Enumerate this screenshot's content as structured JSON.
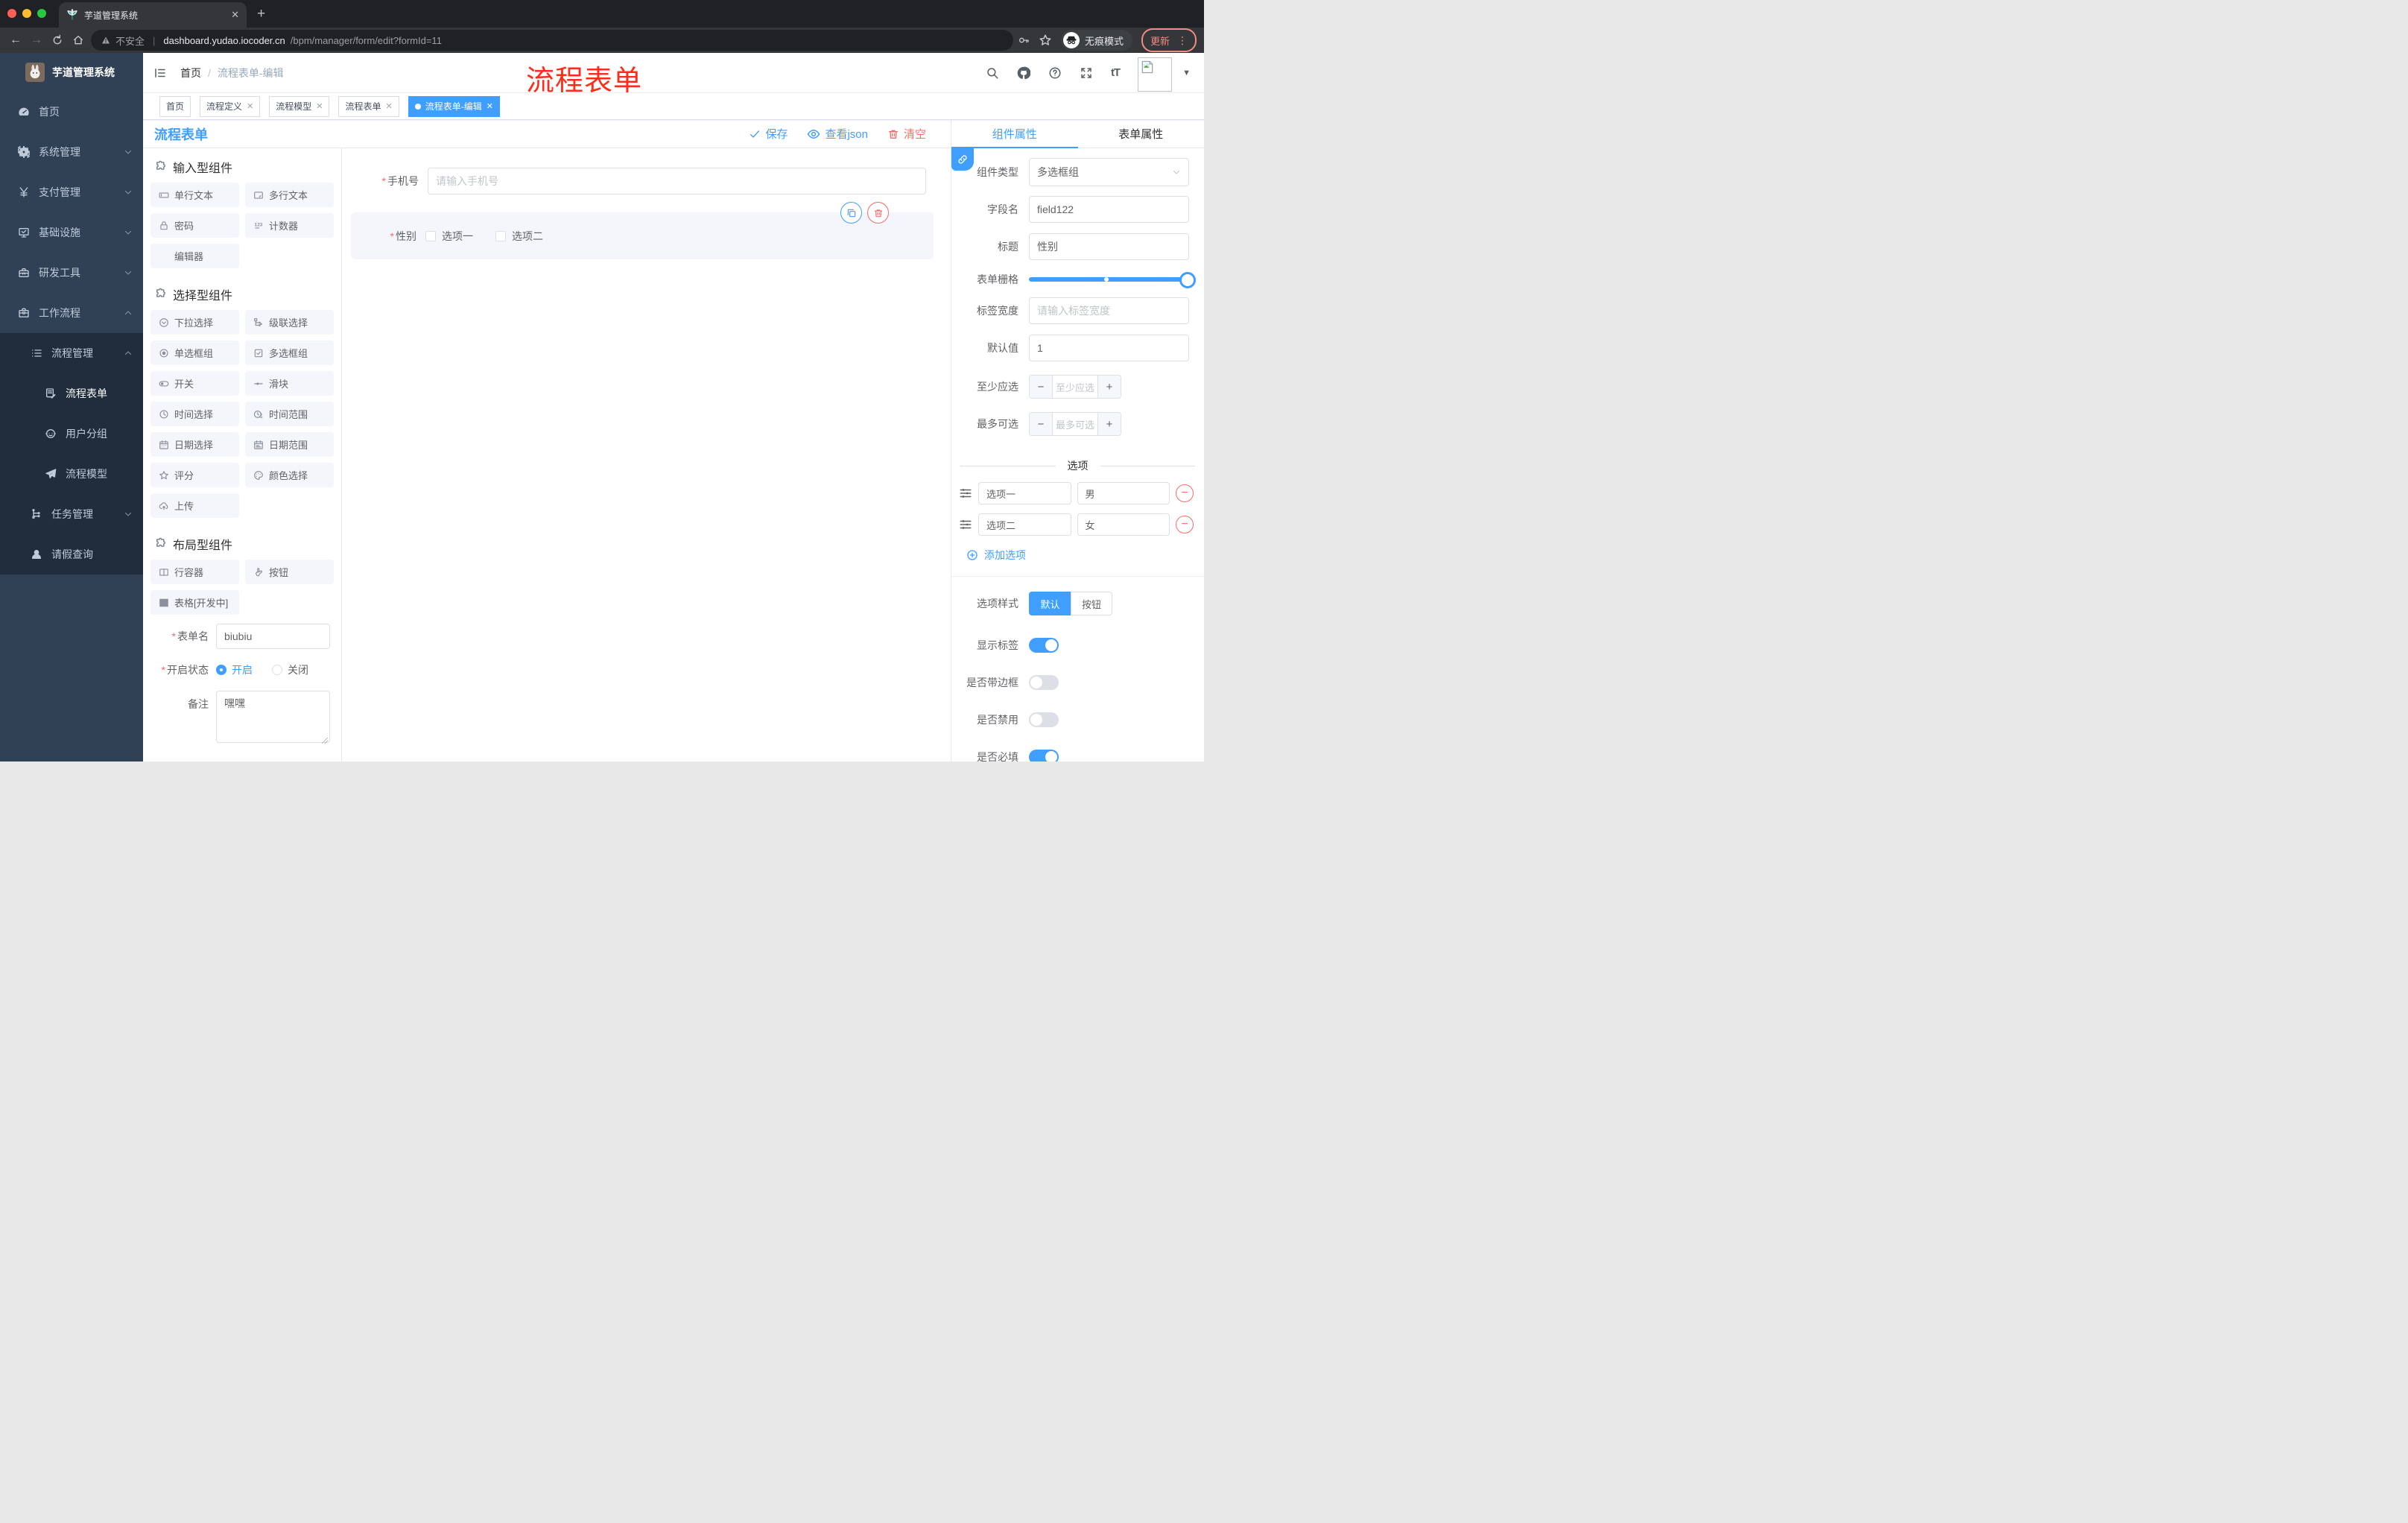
{
  "browser": {
    "tab_title": "芋道管理系统",
    "security_label": "不安全",
    "url_domain": "dashboard.yudao.iocoder.cn",
    "url_path": "/bpm/manager/form/edit?formId=11",
    "incognito_label": "无痕模式",
    "update_label": "更新"
  },
  "sidebar": {
    "logo_title": "芋道管理系统",
    "items": [
      {
        "label": "首页",
        "icon": "dashboard-icon"
      },
      {
        "label": "系统管理",
        "icon": "gear-icon"
      },
      {
        "label": "支付管理",
        "icon": "yen-icon"
      },
      {
        "label": "基础设施",
        "icon": "monitor-icon"
      },
      {
        "label": "研发工具",
        "icon": "toolbox-icon"
      },
      {
        "label": "工作流程",
        "icon": "briefcase-icon"
      }
    ],
    "submenu": {
      "parent": {
        "label": "流程管理",
        "icon": "list-tree-icon"
      },
      "children": [
        {
          "label": "流程表单",
          "icon": "doc-edit-icon"
        },
        {
          "label": "用户分组",
          "icon": "robot-icon"
        },
        {
          "label": "流程模型",
          "icon": "paper-plane-icon"
        }
      ],
      "siblings": [
        {
          "label": "任务管理",
          "icon": "branch-icon"
        },
        {
          "label": "请假查询",
          "icon": "person-icon"
        }
      ]
    }
  },
  "header": {
    "breadcrumb_home": "首页",
    "breadcrumb_current": "流程表单-编辑",
    "annotation": "流程表单"
  },
  "tags": [
    {
      "label": "首页",
      "closable": false,
      "active": false
    },
    {
      "label": "流程定义",
      "closable": true,
      "active": false
    },
    {
      "label": "流程模型",
      "closable": true,
      "active": false
    },
    {
      "label": "流程表单",
      "closable": true,
      "active": false
    },
    {
      "label": "流程表单-编辑",
      "closable": true,
      "active": true
    }
  ],
  "builder": {
    "title": "流程表单",
    "actions": {
      "save": "保存",
      "view_json": "查看json",
      "clear": "清空"
    },
    "left": {
      "sections": [
        {
          "title": "输入型组件",
          "items": [
            {
              "label": "单行文本",
              "icon": "input-box-icon"
            },
            {
              "label": "多行文本",
              "icon": "textarea-box-icon"
            },
            {
              "label": "密码",
              "icon": "lock-icon"
            },
            {
              "label": "计数器",
              "icon": "counter-icon"
            },
            {
              "label": "编辑器",
              "icon": ""
            }
          ]
        },
        {
          "title": "选择型组件",
          "items": [
            {
              "label": "下拉选择",
              "icon": "select-circle-icon"
            },
            {
              "label": "级联选择",
              "icon": "cascade-icon"
            },
            {
              "label": "单选框组",
              "icon": "radio-icon"
            },
            {
              "label": "多选框组",
              "icon": "checkbox-icon"
            },
            {
              "label": "开关",
              "icon": "switch-icon"
            },
            {
              "label": "滑块",
              "icon": "slider-icon"
            },
            {
              "label": "时间选择",
              "icon": "clock-icon"
            },
            {
              "label": "时间范围",
              "icon": "clock-range-icon"
            },
            {
              "label": "日期选择",
              "icon": "calendar-icon"
            },
            {
              "label": "日期范围",
              "icon": "calendar-range-icon"
            },
            {
              "label": "评分",
              "icon": "star-icon"
            },
            {
              "label": "颜色选择",
              "icon": "palette-icon"
            },
            {
              "label": "上传",
              "icon": "cloud-upload-icon"
            }
          ]
        },
        {
          "title": "布局型组件",
          "items": [
            {
              "label": "行容器",
              "icon": "row-split-icon"
            },
            {
              "label": "按钮",
              "icon": "hand-point-icon"
            },
            {
              "label": "表格[开发中]",
              "icon": "table-grid-icon"
            }
          ]
        }
      ],
      "meta": {
        "name_label": "表单名",
        "name_value": "biubiu",
        "status_label": "开启状态",
        "status_on": "开启",
        "status_off": "关闭",
        "remark_label": "备注",
        "remark_value": "嘿嘿"
      }
    },
    "canvas": {
      "phone": {
        "label": "手机号",
        "placeholder": "请输入手机号",
        "required": true
      },
      "gender": {
        "label": "性别",
        "required": true,
        "option1": "选项一",
        "option2": "选项二"
      }
    },
    "right": {
      "tab_component": "组件属性",
      "tab_form": "表单属性",
      "component_type_label": "组件类型",
      "component_type_value": "多选框组",
      "field_name_label": "字段名",
      "field_name_value": "field122",
      "title_label": "标题",
      "title_value": "性别",
      "grid_label": "表单栅格",
      "label_width_label": "标签宽度",
      "label_width_placeholder": "请输入标签宽度",
      "default_label": "默认值",
      "default_value": "1",
      "min_label": "至少应选",
      "min_placeholder": "至少应选",
      "max_label": "最多可选",
      "max_placeholder": "最多可选",
      "options_title": "选项",
      "options": [
        {
          "label": "选项一",
          "value": "男"
        },
        {
          "label": "选项二",
          "value": "女"
        }
      ],
      "add_option": "添加选项",
      "style_label": "选项样式",
      "style_default": "默认",
      "style_button": "按钮",
      "toggles": [
        {
          "label": "显示标签",
          "on": true
        },
        {
          "label": "是否带边框",
          "on": false
        },
        {
          "label": "是否禁用",
          "on": false
        },
        {
          "label": "是否必填",
          "on": true
        }
      ]
    }
  },
  "colors": {
    "accent": "#409EFF",
    "danger": "#F56C6C",
    "sidebar": "#304156",
    "sidebar_dark": "#1f2d3d"
  }
}
